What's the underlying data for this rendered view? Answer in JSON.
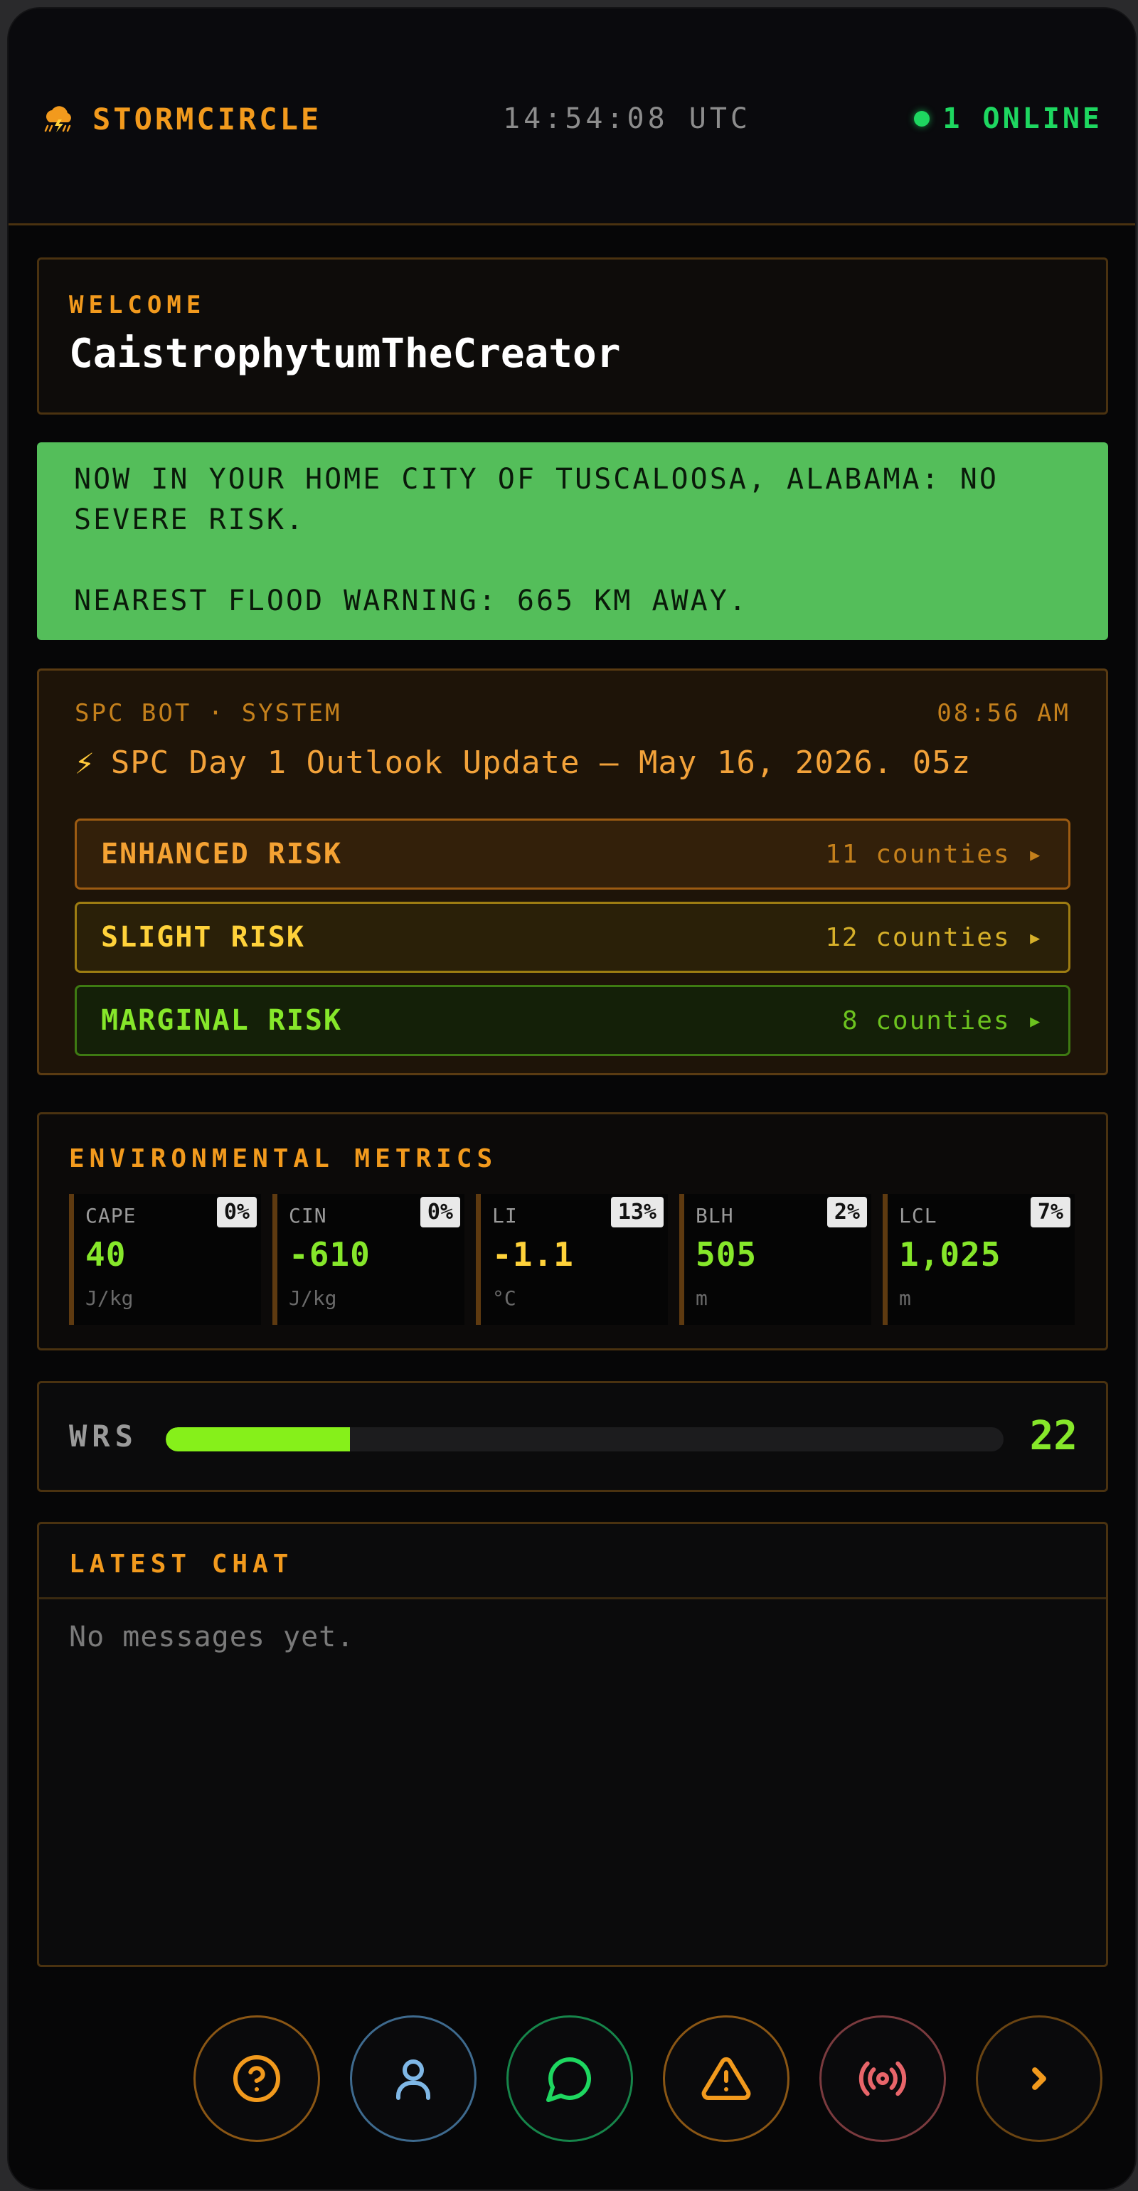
{
  "header": {
    "brand": "STORMCIRCLE",
    "clock": "14:54:08 UTC",
    "online": "1 ONLINE"
  },
  "welcome": {
    "label": "WELCOME",
    "username": "CaistrophytumTheCreator"
  },
  "alert": {
    "line1": "NOW IN YOUR HOME CITY OF TUSCALOOSA, ALABAMA: NO SEVERE RISK.",
    "line2": "NEAREST FLOOD WARNING: 665 KM AWAY."
  },
  "spc": {
    "source": "SPC BOT · SYSTEM",
    "time": "08:56 AM",
    "title": "SPC Day 1 Outlook Update — May 16, 2026. 05z",
    "risks": [
      {
        "name": "ENHANCED RISK",
        "count": "11 counties ▸"
      },
      {
        "name": "SLIGHT RISK",
        "count": "12 counties ▸"
      },
      {
        "name": "MARGINAL RISK",
        "count": "8 counties ▸"
      }
    ]
  },
  "metrics": {
    "label": "ENVIRONMENTAL METRICS",
    "items": [
      {
        "name": "CAPE",
        "pct": "0%",
        "value": "40",
        "unit": "J/kg"
      },
      {
        "name": "CIN",
        "pct": "0%",
        "value": "-610",
        "unit": "J/kg"
      },
      {
        "name": "LI",
        "pct": "13%",
        "value": "-1.1",
        "unit": "°C"
      },
      {
        "name": "BLH",
        "pct": "2%",
        "value": "505",
        "unit": "m"
      },
      {
        "name": "LCL",
        "pct": "7%",
        "value": "1,025",
        "unit": "m"
      }
    ]
  },
  "wrs": {
    "label": "WRS",
    "value": "22",
    "fill_fraction": 0.22
  },
  "chat": {
    "label": "LATEST CHAT",
    "empty": "No messages yet."
  },
  "nav": {
    "items": [
      {
        "icon": "help-icon",
        "color": "#f29a1d"
      },
      {
        "icon": "user-icon",
        "color": "#7fb7e6"
      },
      {
        "icon": "chat-icon",
        "color": "#1ed760"
      },
      {
        "icon": "warning-icon",
        "color": "#f29a1d"
      },
      {
        "icon": "broadcast-icon",
        "color": "#e8656a"
      },
      {
        "icon": "next-icon",
        "color": "#f29a1d"
      }
    ]
  },
  "colors": {
    "accent": "#f29a1d",
    "online": "#1ed760",
    "alert_bg": "#54be5a",
    "wrs_fill": "#86f01a"
  }
}
